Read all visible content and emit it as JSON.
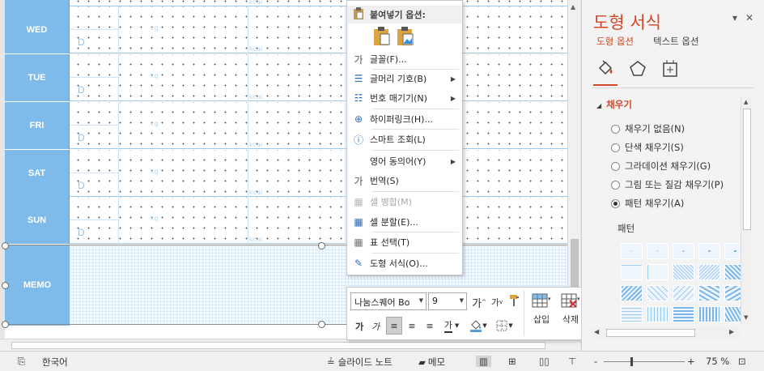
{
  "slide": {
    "days": [
      "WED",
      "TUE",
      "FRI",
      "SAT",
      "SUN"
    ],
    "d_label": "D",
    "kg_label": "kg",
    "kcal_label": "kcal",
    "memo_label": "MEMO"
  },
  "context_menu": {
    "paste_header": "붙여넣기 옵션:",
    "items": [
      {
        "label": "글꼴(F)...",
        "icon": "font-icon",
        "glyph": "가"
      },
      {
        "label": "글머리 기호(B)",
        "icon": "bullets-icon",
        "glyph": "☰",
        "submenu": true
      },
      {
        "label": "번호 매기기(N)",
        "icon": "numbering-icon",
        "glyph": "☷",
        "submenu": true
      },
      {
        "label": "하이퍼링크(H)...",
        "icon": "hyperlink-icon",
        "glyph": "⊕"
      },
      {
        "label": "스마트 조회(L)",
        "icon": "smart-lookup-icon",
        "glyph": "ⓘ"
      },
      {
        "label": "영어 동의어(Y)",
        "icon": "synonyms-icon",
        "glyph": "",
        "submenu": true
      },
      {
        "label": "번역(S)",
        "icon": "translate-icon",
        "glyph": "가"
      },
      {
        "label": "셀 병합(M)",
        "icon": "merge-cells-icon",
        "glyph": "▦",
        "disabled": true
      },
      {
        "label": "셀 분할(E)...",
        "icon": "split-cells-icon",
        "glyph": "▦"
      },
      {
        "label": "표 선택(T)",
        "icon": "select-table-icon",
        "glyph": "▦"
      },
      {
        "label": "도형 서식(O)...",
        "icon": "format-shape-icon",
        "glyph": "✎"
      }
    ]
  },
  "mini_toolbar": {
    "font_name": "나눔스퀘어 Bo",
    "font_size": "9",
    "grow_label": "가",
    "shrink_label": "가",
    "bold_label": "가",
    "italic_label": "가",
    "insert_label": "삽입",
    "delete_label": "삭제",
    "text_color_label": "가"
  },
  "pane": {
    "title": "도형 서식",
    "tab_shape": "도형 옵션",
    "tab_text": "텍스트 옵션",
    "section": "채우기",
    "fill_options": [
      {
        "label": "채우기 없음(N)",
        "selected": false
      },
      {
        "label": "단색 채우기(S)",
        "selected": false
      },
      {
        "label": "그라데이션 채우기(G)",
        "selected": false
      },
      {
        "label": "그림 또는 질감 채우기(P)",
        "selected": false
      },
      {
        "label": "패턴 채우기(A)",
        "selected": true
      }
    ],
    "pattern_label": "패턴",
    "accent_color": "#d24726"
  },
  "status_bar": {
    "language": "한국어",
    "notes": "슬라이드 노트",
    "comments": "메모",
    "zoom": "75 %",
    "zoom_minus": "-",
    "zoom_plus": "+"
  }
}
